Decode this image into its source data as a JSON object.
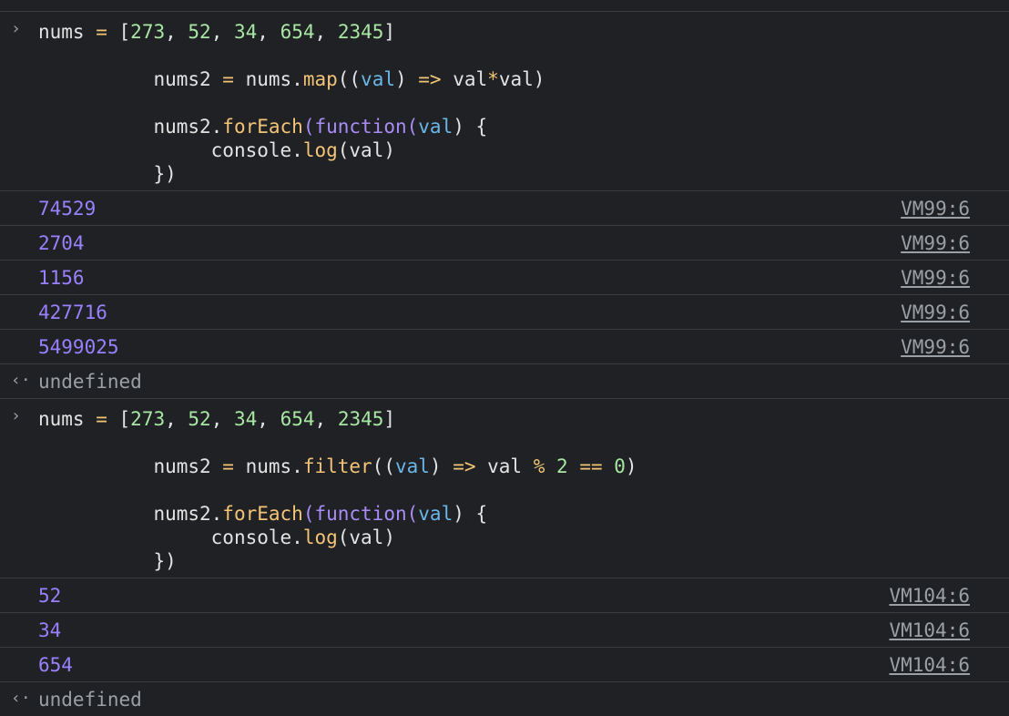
{
  "colors": {
    "background": "#202124",
    "log_value": "#9980ff",
    "source_link": "#9aa0a6",
    "result_text": "#9aa0a6",
    "keyword": "#a98cf7",
    "function_name": "#f3c477",
    "parameter": "#6bb6e8",
    "number": "#a8e6a3"
  },
  "icons": {
    "prompt": "›",
    "result": "‹·"
  },
  "entries": [
    {
      "input": {
        "line1": {
          "a": "nums",
          "op": " = ",
          "b": "[",
          "n1": "273",
          "c1": ", ",
          "n2": "52",
          "c2": ", ",
          "n3": "34",
          "c3": ", ",
          "n4": "654",
          "c4": ", ",
          "n5": "2345",
          "e": "]"
        },
        "line2": {
          "indent": "          ",
          "a": "nums2",
          "op": " = ",
          "b": "nums.",
          "fn": "map",
          "c": "((",
          "p": "val",
          "d": ") ",
          "arrow": "=>",
          "e": " val",
          "star": "*",
          "f": "val)"
        },
        "line3": {
          "indent": "          ",
          "a": "nums2.",
          "fn": "forEach",
          "b": "(",
          "kw": "function",
          "c": "(",
          "p": "val",
          "d": ") {"
        },
        "line4": {
          "indent": "               ",
          "a": "console.",
          "fn": "log",
          "b": "(val)"
        },
        "line5": {
          "indent": "          ",
          "a": "})"
        }
      },
      "logs": [
        {
          "value": "74529",
          "source": "VM99:6"
        },
        {
          "value": "2704",
          "source": "VM99:6"
        },
        {
          "value": "1156",
          "source": "VM99:6"
        },
        {
          "value": "427716",
          "source": "VM99:6"
        },
        {
          "value": "5499025",
          "source": "VM99:6"
        }
      ],
      "result": "undefined"
    },
    {
      "input": {
        "line1": {
          "a": "nums",
          "op": " = ",
          "b": "[",
          "n1": "273",
          "c1": ", ",
          "n2": "52",
          "c2": ", ",
          "n3": "34",
          "c3": ", ",
          "n4": "654",
          "c4": ", ",
          "n5": "2345",
          "e": "]"
        },
        "line2": {
          "indent": "          ",
          "a": "nums2",
          "op": " = ",
          "b": "nums.",
          "fn": "filter",
          "c": "((",
          "p": "val",
          "d": ") ",
          "arrow": "=>",
          "e": " val ",
          "mod": "%",
          "sp": " ",
          "two": "2",
          "eq": " == ",
          "zero": "0",
          "f": ")"
        },
        "line3": {
          "indent": "          ",
          "a": "nums2.",
          "fn": "forEach",
          "b": "(",
          "kw": "function",
          "c": "(",
          "p": "val",
          "d": ") {"
        },
        "line4": {
          "indent": "               ",
          "a": "console.",
          "fn": "log",
          "b": "(val)"
        },
        "line5": {
          "indent": "          ",
          "a": "})"
        }
      },
      "logs": [
        {
          "value": "52",
          "source": "VM104:6"
        },
        {
          "value": "34",
          "source": "VM104:6"
        },
        {
          "value": "654",
          "source": "VM104:6"
        }
      ],
      "result": "undefined"
    }
  ]
}
